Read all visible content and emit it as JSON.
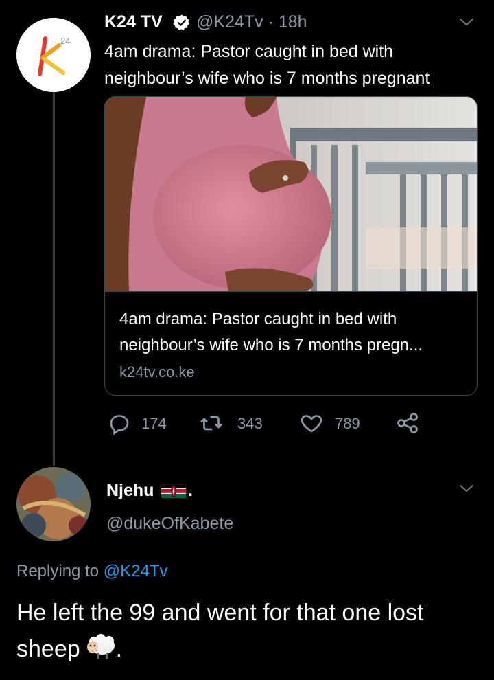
{
  "tweet1": {
    "avatar_icon": "k24-logo",
    "display_name": "K24 TV",
    "verified_icon": "verified-badge-icon",
    "handle": "@K24Tv",
    "separator": "·",
    "time": "18h",
    "text": "4am drama: Pastor caught in bed with neighbour’s wife who is 7 months pregnant",
    "card": {
      "image": "photo of pregnant woman in pink dress beside a crib",
      "title": "4am drama: Pastor caught in bed with neighbour’s wife who is 7 months pregn...",
      "domain": "k24tv.co.ke"
    },
    "actions": {
      "reply_count": "174",
      "retweet_count": "343",
      "like_count": "789"
    }
  },
  "tweet2": {
    "display_name": "Njehu",
    "flag_icon": "kenya-flag-icon",
    "name_suffix": ".",
    "handle": "@dukeOfKabete",
    "replying_prefix": "Replying to",
    "replying_to": "@K24Tv",
    "text": "He left the 99 and went for that one lost sheep",
    "text_suffix": ".",
    "emoji_icon": "sheep-emoji-icon"
  },
  "colors": {
    "background": "#000000",
    "text": "#ffffff",
    "secondary": "#8b98a5",
    "link": "#1d9bf0",
    "border": "#38444d"
  }
}
